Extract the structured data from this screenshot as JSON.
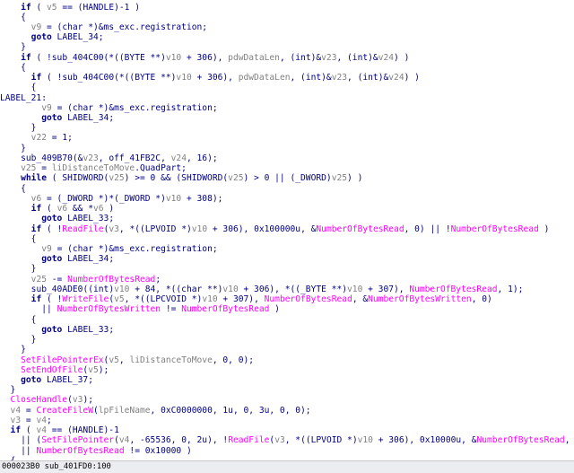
{
  "code_lines": [
    [
      [
        "k",
        "if"
      ],
      [
        "p",
        " ( "
      ],
      [
        "v",
        "v5"
      ],
      [
        "p",
        " == (HANDLE)-1 )"
      ]
    ],
    [
      [
        "p",
        "{"
      ]
    ],
    [
      [
        "v",
        "v9"
      ],
      [
        "p",
        " = (char *)&ms_exc.registration;"
      ]
    ],
    [
      [
        "k",
        "goto"
      ],
      [
        "p",
        " LABEL_34;"
      ]
    ],
    [
      [
        "p",
        "}"
      ]
    ],
    [
      [
        "k",
        "if"
      ],
      [
        "p",
        " ( !sub_404C00(*((BYTE **)"
      ],
      [
        "v",
        "v10"
      ],
      [
        "p",
        " + 306), "
      ],
      [
        "v",
        "pdwDataLen"
      ],
      [
        "p",
        ", (int)&"
      ],
      [
        "v",
        "v23"
      ],
      [
        "p",
        ", (int)&"
      ],
      [
        "v",
        "v24"
      ],
      [
        "p",
        ") )"
      ]
    ],
    [
      [
        "p",
        "{"
      ]
    ],
    [
      [
        "k",
        "if"
      ],
      [
        "p",
        " ( !sub_404C00(*((BYTE **)"
      ],
      [
        "v",
        "v10"
      ],
      [
        "p",
        " + 306), "
      ],
      [
        "v",
        "pdwDataLen"
      ],
      [
        "p",
        ", (int)&"
      ],
      [
        "v",
        "v23"
      ],
      [
        "p",
        ", (int)&"
      ],
      [
        "v",
        "v24"
      ],
      [
        "p",
        ") )"
      ]
    ],
    [
      [
        "p",
        "{"
      ]
    ],
    [
      [
        "l",
        "LABEL_21:"
      ]
    ],
    [
      [
        "v",
        "v9"
      ],
      [
        "p",
        " = (char *)&ms_exc.registration;"
      ]
    ],
    [
      [
        "k",
        "goto"
      ],
      [
        "p",
        " LABEL_34;"
      ]
    ],
    [
      [
        "p",
        "}"
      ]
    ],
    [
      [
        "v",
        "v22"
      ],
      [
        "p",
        " = 1;"
      ]
    ],
    [
      [
        "p",
        "}"
      ]
    ],
    [
      [
        "f",
        "sub_409B70"
      ],
      [
        "p",
        "(&"
      ],
      [
        "v",
        "v23"
      ],
      [
        "p",
        ", off_41FB2C, "
      ],
      [
        "v",
        "v24"
      ],
      [
        "p",
        ", 16);"
      ]
    ],
    [
      [
        "v",
        "v25"
      ],
      [
        "p",
        " = "
      ],
      [
        "v",
        "liDistanceToMove"
      ],
      [
        "p",
        ".QuadPart;"
      ]
    ],
    [
      [
        "k",
        "while"
      ],
      [
        "p",
        " ( SHIDWORD("
      ],
      [
        "v",
        "v25"
      ],
      [
        "p",
        ") >= 0 && (SHIDWORD("
      ],
      [
        "v",
        "v25"
      ],
      [
        "p",
        ") > 0 || (_DWORD)"
      ],
      [
        "v",
        "v25"
      ],
      [
        "p",
        ") )"
      ]
    ],
    [
      [
        "p",
        "{"
      ]
    ],
    [
      [
        "v",
        "v6"
      ],
      [
        "p",
        " = (_DWORD *)*(_DWORD *)"
      ],
      [
        "v",
        "v10"
      ],
      [
        "p",
        " + 308);"
      ]
    ],
    [
      [
        "k",
        "if"
      ],
      [
        "p",
        " ( "
      ],
      [
        "v",
        "v6"
      ],
      [
        "p",
        " && *"
      ],
      [
        "v",
        "v6"
      ],
      [
        "p",
        " )"
      ]
    ],
    [
      [
        "k",
        "goto"
      ],
      [
        "p",
        " LABEL_33;"
      ]
    ],
    [
      [
        "k",
        "if"
      ],
      [
        "p",
        " ( !"
      ],
      [
        "i",
        "ReadFile"
      ],
      [
        "p",
        "("
      ],
      [
        "v",
        "v3"
      ],
      [
        "p",
        ", *((LPVOID *)"
      ],
      [
        "v",
        "v10"
      ],
      [
        "p",
        " + 306), 0x100000u, &"
      ],
      [
        "i",
        "NumberOfBytesRead"
      ],
      [
        "p",
        ", 0) || !"
      ],
      [
        "i",
        "NumberOfBytesRead"
      ],
      [
        "p",
        " )"
      ]
    ],
    [
      [
        "p",
        "{"
      ]
    ],
    [
      [
        "v",
        "v9"
      ],
      [
        "p",
        " = (char *)&ms_exc.registration;"
      ]
    ],
    [
      [
        "k",
        "goto"
      ],
      [
        "p",
        " LABEL_34;"
      ]
    ],
    [
      [
        "p",
        "}"
      ]
    ],
    [
      [
        "v",
        "v25"
      ],
      [
        "p",
        " -= "
      ],
      [
        "i",
        "NumberOfBytesRead"
      ],
      [
        "p",
        ";"
      ]
    ],
    [
      [
        "f",
        "sub_40ADE0"
      ],
      [
        "p",
        "((int)"
      ],
      [
        "v",
        "v10"
      ],
      [
        "p",
        " + 84, *((char **)"
      ],
      [
        "v",
        "v10"
      ],
      [
        "p",
        " + 306), *((_BYTE **)"
      ],
      [
        "v",
        "v10"
      ],
      [
        "p",
        " + 307), "
      ],
      [
        "i",
        "NumberOfBytesRead"
      ],
      [
        "p",
        ", 1);"
      ]
    ],
    [
      [
        "k",
        "if"
      ],
      [
        "p",
        " ( !"
      ],
      [
        "i",
        "WriteFile"
      ],
      [
        "p",
        "("
      ],
      [
        "v",
        "v5"
      ],
      [
        "p",
        ", *((LPCVOID *)"
      ],
      [
        "v",
        "v10"
      ],
      [
        "p",
        " + 307), "
      ],
      [
        "i",
        "NumberOfBytesRead"
      ],
      [
        "p",
        ", &"
      ],
      [
        "i",
        "NumberOfBytesWritten"
      ],
      [
        "p",
        ", 0)"
      ]
    ],
    [
      [
        "p",
        "|| "
      ],
      [
        "i",
        "NumberOfBytesWritten"
      ],
      [
        "p",
        " != "
      ],
      [
        "i",
        "NumberOfBytesRead"
      ],
      [
        "p",
        " )"
      ]
    ],
    [
      [
        "p",
        "{"
      ]
    ],
    [
      [
        "k",
        "goto"
      ],
      [
        "p",
        " LABEL_33;"
      ]
    ],
    [
      [
        "p",
        "}"
      ]
    ],
    [
      [
        "p",
        "}"
      ]
    ],
    [
      [
        "i",
        "SetFilePointerEx"
      ],
      [
        "p",
        "("
      ],
      [
        "v",
        "v5"
      ],
      [
        "p",
        ", "
      ],
      [
        "v",
        "liDistanceToMove"
      ],
      [
        "p",
        ", 0, 0);"
      ]
    ],
    [
      [
        "i",
        "SetEndOfFile"
      ],
      [
        "p",
        "("
      ],
      [
        "v",
        "v5"
      ],
      [
        "p",
        ");"
      ]
    ],
    [
      [
        "k",
        "goto"
      ],
      [
        "p",
        " LABEL_37;"
      ]
    ],
    [
      [
        "p",
        "}"
      ]
    ],
    [
      [
        "i",
        "CloseHandle"
      ],
      [
        "p",
        "("
      ],
      [
        "v",
        "v3"
      ],
      [
        "p",
        ");"
      ]
    ],
    [
      [
        "v",
        "v4"
      ],
      [
        "p",
        " = "
      ],
      [
        "i",
        "CreateFileW"
      ],
      [
        "p",
        "("
      ],
      [
        "v",
        "lpFileName"
      ],
      [
        "p",
        ", 0xC0000000, 1u, 0, 3u, 0, 0);"
      ]
    ],
    [
      [
        "v",
        "v3"
      ],
      [
        "p",
        " = "
      ],
      [
        "v",
        "v4"
      ],
      [
        "p",
        ";"
      ]
    ],
    [
      [
        "k",
        "if"
      ],
      [
        "p",
        " ( "
      ],
      [
        "v",
        "v4"
      ],
      [
        "p",
        " == (HANDLE)-1"
      ]
    ],
    [
      [
        "p",
        "|| ("
      ],
      [
        "i",
        "SetFilePointer"
      ],
      [
        "p",
        "("
      ],
      [
        "v",
        "v4"
      ],
      [
        "p",
        ", -65536, 0, 2u), !"
      ],
      [
        "i",
        "ReadFile"
      ],
      [
        "p",
        "("
      ],
      [
        "v",
        "v3"
      ],
      [
        "p",
        ", *((LPVOID *)"
      ],
      [
        "v",
        "v10"
      ],
      [
        "p",
        " + 306), 0x10000u, &"
      ],
      [
        "i",
        "NumberOfBytesRead"
      ],
      [
        "p",
        ", 0))"
      ]
    ],
    [
      [
        "p",
        "|| "
      ],
      [
        "i",
        "NumberOfBytesRead"
      ],
      [
        "p",
        " != 0x10000 )"
      ]
    ],
    [
      [
        "p",
        "{"
      ]
    ]
  ],
  "status_bar": {
    "text": "000023B0 sub_401FD0:100"
  },
  "colors": {
    "plain": "#000080",
    "variable": "#808080",
    "import": "#ff00ff",
    "status_bg": "#ecedf0"
  }
}
